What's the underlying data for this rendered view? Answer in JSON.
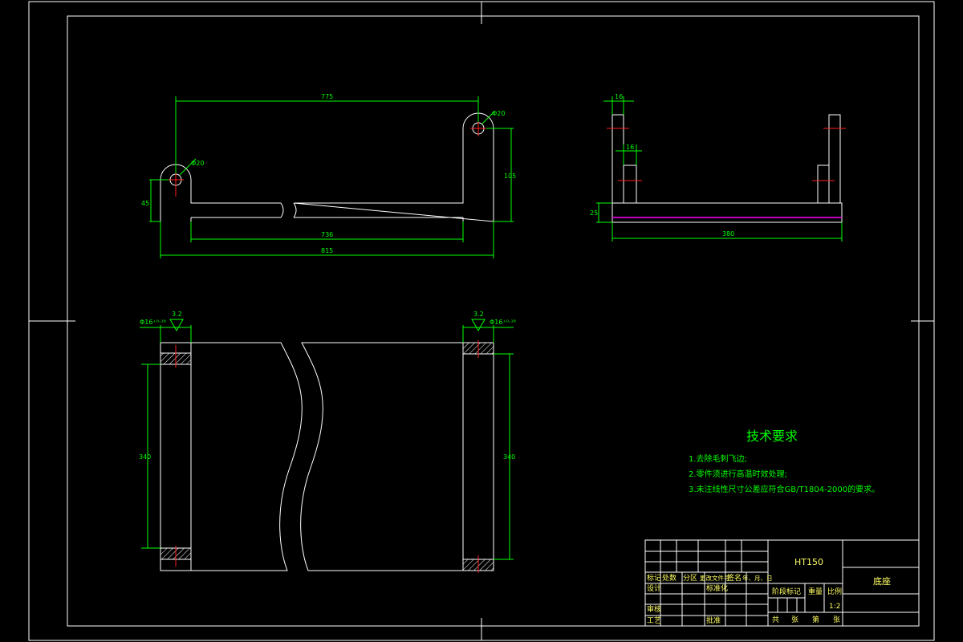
{
  "drawing": {
    "part_name": "底座",
    "material": "HT150",
    "scale": "1:2"
  },
  "tech_requirements": {
    "title": "技术要求",
    "items": [
      "1.去除毛刺飞边;",
      "2.零件须进行高温时效处理;",
      "3.未注线性尺寸公差应符合GB/T1804-2000的要求。"
    ]
  },
  "dimensions": {
    "front_top_length": "775",
    "front_inner_length": "736",
    "front_total_length": "815",
    "left_hole_dia": "Φ20",
    "right_hole_dia": "Φ20",
    "left_height": "45",
    "right_height": "105",
    "side_top_width": "16",
    "side_inner_width": "16",
    "side_base_height": "25",
    "side_total_width": "380",
    "plan_left_height": "340",
    "plan_right_height": "340",
    "plan_left_hole": "Φ16⁺⁰·¹⁸",
    "plan_right_hole": "Φ16⁺⁰·¹⁸",
    "roughness_left": "3.2",
    "roughness_right": "3.2"
  },
  "title_block": {
    "row_headers": [
      "标记",
      "处数",
      "分区",
      "更改文件号",
      "签名",
      "年、月、日"
    ],
    "design": "设计",
    "standardize": "标准化",
    "review": "审核",
    "process": "工艺",
    "approve": "批准",
    "stage_mark": "阶段标记",
    "weight": "重量",
    "ratio": "比例",
    "total_label": "共",
    "sheet_label": "张",
    "page_label": "第",
    "page_sheet_label": "张"
  }
}
